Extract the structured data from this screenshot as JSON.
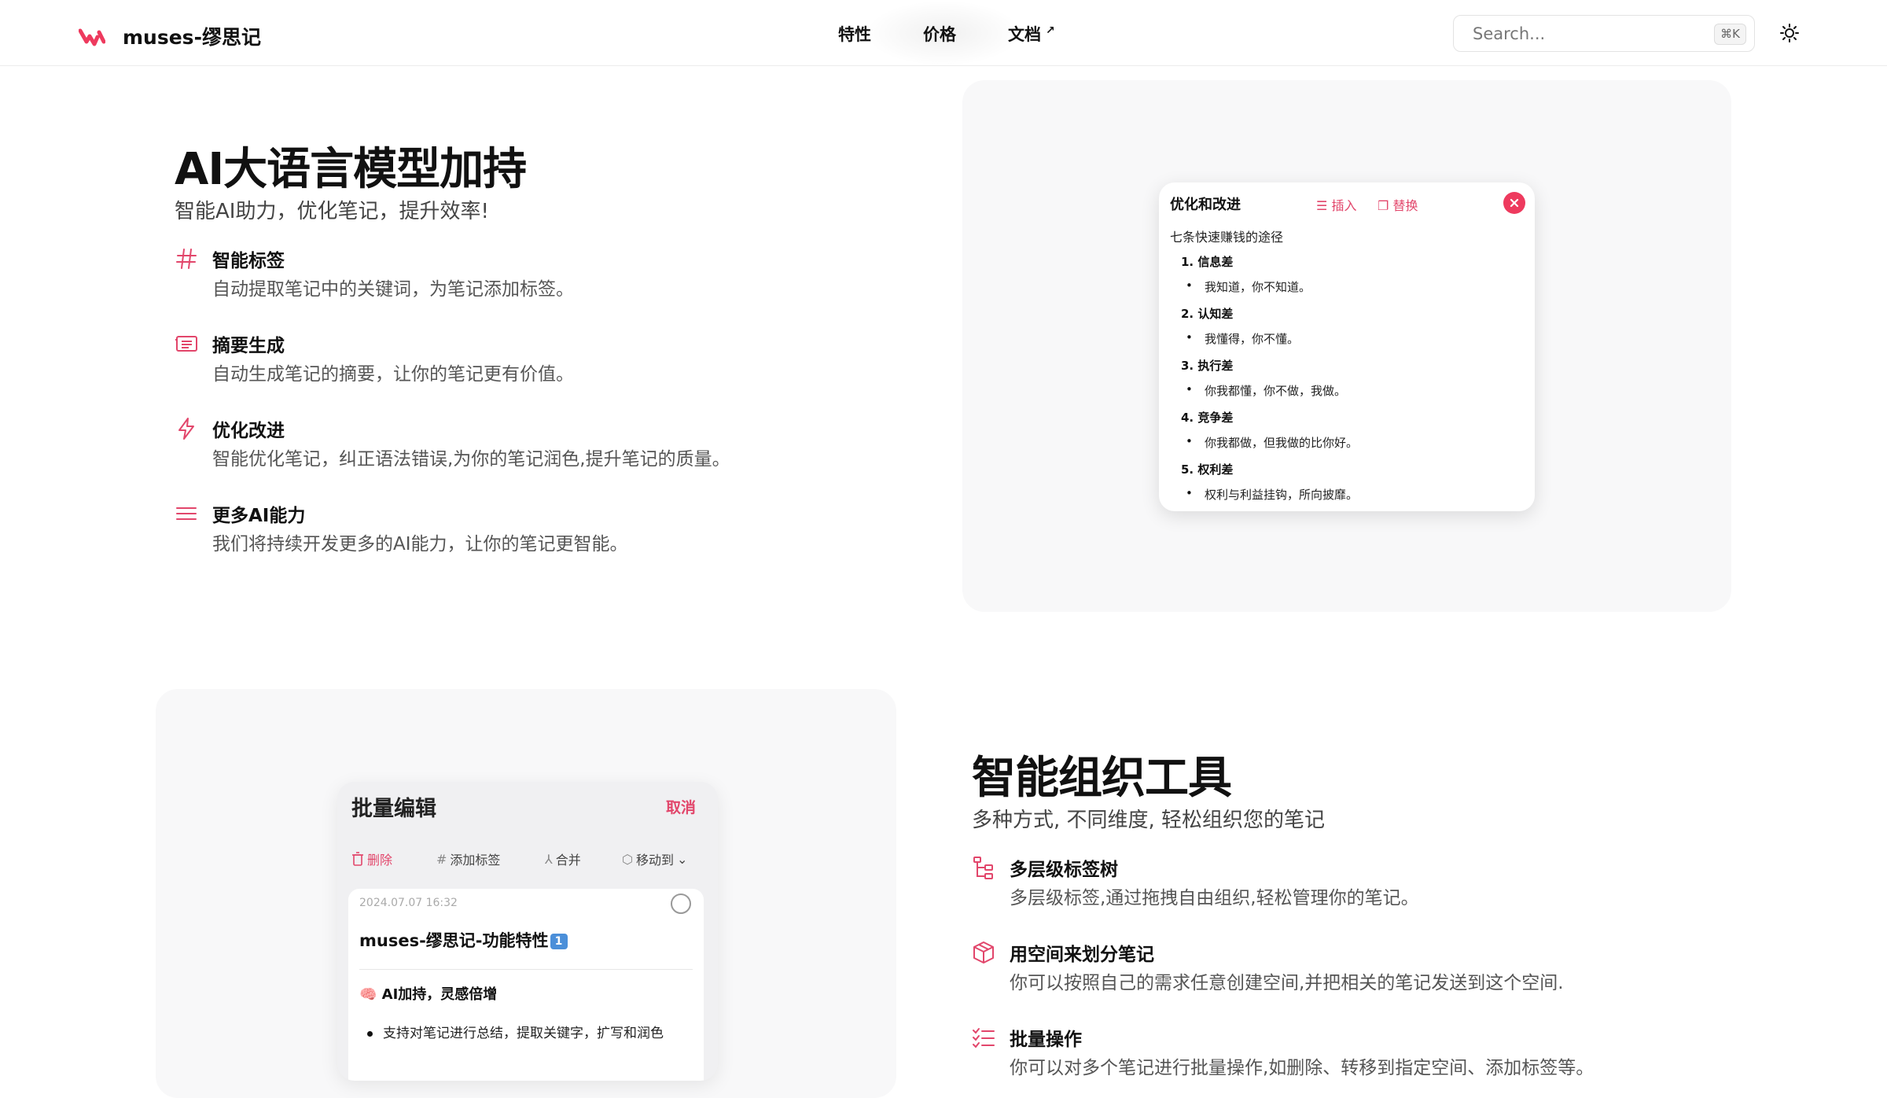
{
  "header": {
    "brand": "muses-缪思记",
    "nav": [
      {
        "label": "特性"
      },
      {
        "label": "价格"
      },
      {
        "label": "文档"
      }
    ],
    "nav_external_mark": "↗",
    "search": {
      "placeholder": "Search...",
      "shortcut": "⌘K"
    }
  },
  "ai_section": {
    "title": "AI大语言模型加持",
    "subtitle": "智能AI助力，优化笔记，提升效率!",
    "features": [
      {
        "icon": "hash-icon",
        "title": "智能标签",
        "desc": "自动提取笔记中的关键词，为笔记添加标签。"
      },
      {
        "icon": "summary-icon",
        "title": "摘要生成",
        "desc": "自动生成笔记的摘要，让你的笔记更有价值。"
      },
      {
        "icon": "lightning-icon",
        "title": "优化改进",
        "desc": "智能优化笔记，纠正语法错误,为你的笔记润色,提升笔记的质量。"
      },
      {
        "icon": "menu-icon",
        "title": "更多AI能力",
        "desc": "我们将持续开发更多的AI能力，让你的笔记更智能。"
      }
    ],
    "optimize_card": {
      "title": "优化和改进",
      "insert_label": "插入",
      "replace_label": "替换",
      "heading": "七条快速赚钱的途径",
      "items": [
        {
          "num": "1.",
          "title": "信息差",
          "bullet": "我知道，你不知道。"
        },
        {
          "num": "2.",
          "title": "认知差",
          "bullet": "我懂得，你不懂。"
        },
        {
          "num": "3.",
          "title": "执行差",
          "bullet": "你我都懂，你不做，我做。"
        },
        {
          "num": "4.",
          "title": "竞争差",
          "bullet": "你我都做，但我做的比你好。"
        },
        {
          "num": "5.",
          "title": "权利差",
          "bullet": "权利与利益挂钩，所向披靡。"
        }
      ]
    }
  },
  "org_section": {
    "title": "智能组织工具",
    "subtitle": "多种方式, 不同维度, 轻松组织您的笔记",
    "features": [
      {
        "icon": "tree-icon",
        "title": "多层级标签树",
        "desc": "多层级标签,通过拖拽自由组织,轻松管理你的笔记。"
      },
      {
        "icon": "cube-icon",
        "title": "用空间来划分笔记",
        "desc": "你可以按照自己的需求任意创建空间,并把相关的笔记发送到这个空间."
      },
      {
        "icon": "checklist-icon",
        "title": "批量操作",
        "desc": "你可以对多个笔记进行批量操作,如删除、转移到指定空间、添加标签等。"
      }
    ],
    "batch_card": {
      "title": "批量编辑",
      "cancel": "取消",
      "tools": {
        "delete": "删除",
        "add_tag": "添加标签",
        "merge": "合并",
        "move_to": "移动到"
      },
      "note": {
        "date": "2024.07.07 16:32",
        "title": "muses-缪思记-功能特性",
        "badge": "1",
        "heading": "🧠 AI加持，灵感倍增",
        "bullet": "支持对笔记进行总结，提取关键字，扩写和润色"
      }
    }
  },
  "colors": {
    "accent": "#e2466b",
    "panel": "#f8f8f9",
    "text": "#111111",
    "muted": "#555555"
  }
}
